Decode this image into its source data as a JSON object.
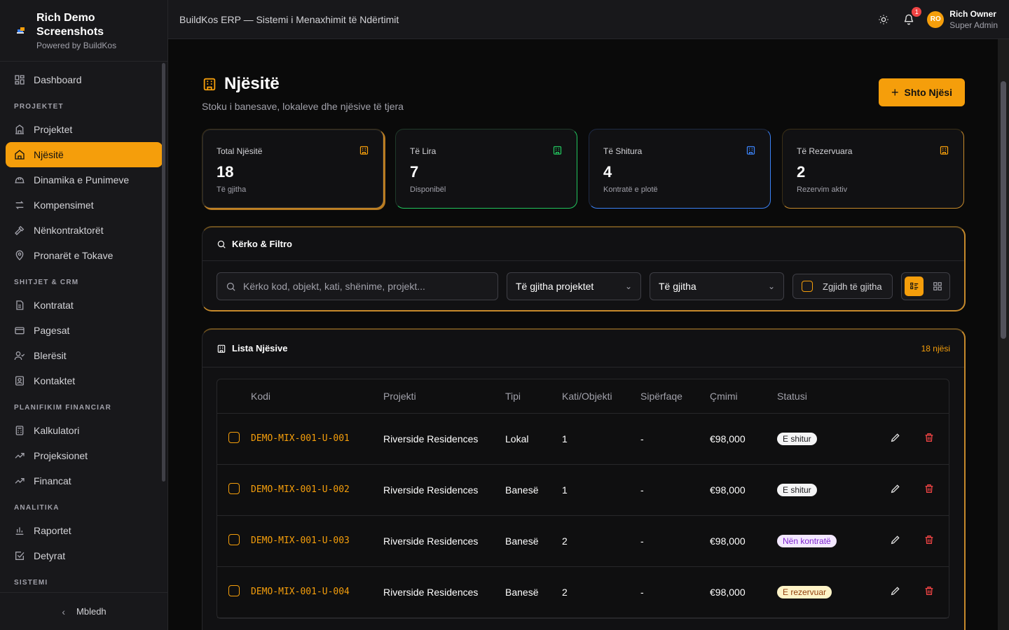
{
  "brand": {
    "name": "Rich Demo Screenshots",
    "sub": "Powered by BuildKos"
  },
  "header": {
    "title": "BuildKos ERP — Sistemi i Menaxhimit të Ndërtimit",
    "notif_count": "1",
    "user": {
      "initials": "RO",
      "name": "Rich Owner",
      "role": "Super Admin"
    }
  },
  "sidebar": {
    "dashboard": "Dashboard",
    "sections": {
      "projektet": "PROJEKTET",
      "shitjet": "SHITJET & CRM",
      "planifikim": "PLANIFIKIM FINANCIAR",
      "analitika": "ANALITIKA",
      "sistemi": "SISTEMI"
    },
    "items": [
      "Projektet",
      "Njësitë",
      "Dinamika e Punimeve",
      "Kompensimet",
      "Nënkontraktorët",
      "Pronarët e Tokave",
      "Kontratat",
      "Pagesat",
      "Blerësit",
      "Kontaktet",
      "Kalkulatori",
      "Projeksionet",
      "Financat",
      "Raportet",
      "Detyrat"
    ],
    "collapse": "Mbledh"
  },
  "page": {
    "title": "Njësitë",
    "subtitle": "Stoku i banesave, lokaleve dhe njësive të tjera",
    "add_button": "Shto Njësi"
  },
  "stats": [
    {
      "label": "Total Njësitë",
      "value": "18",
      "note": "Të gjitha"
    },
    {
      "label": "Të Lira",
      "value": "7",
      "note": "Disponibël"
    },
    {
      "label": "Të Shitura",
      "value": "4",
      "note": "Kontratë e plotë"
    },
    {
      "label": "Të Rezervuara",
      "value": "2",
      "note": "Rezervim aktiv"
    }
  ],
  "filters": {
    "title": "Kërko & Filtro",
    "search_placeholder": "Kërko kod, objekt, kati, shënime, projekt...",
    "project_select": "Të gjitha projektet",
    "status_select": "Të gjitha",
    "select_all": "Zgjidh të gjitha"
  },
  "list": {
    "title": "Lista Njësive",
    "count": "18 njësi",
    "columns": [
      "Kodi",
      "Projekti",
      "Tipi",
      "Kati/Objekti",
      "Sipërfaqe",
      "Çmimi",
      "Statusi"
    ],
    "rows": [
      {
        "code": "DEMO-MIX-001-U-001",
        "project": "Riverside Residences",
        "type": "Lokal",
        "floor": "1",
        "area": "-",
        "price": "€98,000",
        "status": "E shitur"
      },
      {
        "code": "DEMO-MIX-001-U-002",
        "project": "Riverside Residences",
        "type": "Banesë",
        "floor": "1",
        "area": "-",
        "price": "€98,000",
        "status": "E shitur"
      },
      {
        "code": "DEMO-MIX-001-U-003",
        "project": "Riverside Residences",
        "type": "Banesë",
        "floor": "2",
        "area": "-",
        "price": "€98,000",
        "status": "Nën kontratë"
      },
      {
        "code": "DEMO-MIX-001-U-004",
        "project": "Riverside Residences",
        "type": "Banesë",
        "floor": "2",
        "area": "-",
        "price": "€98,000",
        "status": "E rezervuar"
      }
    ]
  },
  "colors": {
    "accent": "#f59e0b",
    "green": "#22c55e",
    "blue": "#3b82f6",
    "danger": "#ef4444"
  }
}
